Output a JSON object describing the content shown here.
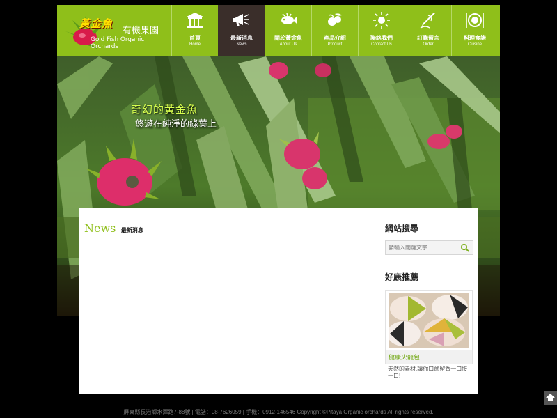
{
  "brand": {
    "stylized": "黃金魚",
    "name_cn": "有機果園",
    "name_en": "Gold Fish Organic Orchards"
  },
  "nav": [
    {
      "label": "首頁",
      "sub": "Home",
      "icon": "gate-icon",
      "active": false
    },
    {
      "label": "最新消息",
      "sub": "News",
      "icon": "megaphone-icon",
      "active": true
    },
    {
      "label": "關於黃金魚",
      "sub": "About Us",
      "icon": "fish-icon",
      "active": false
    },
    {
      "label": "產品介紹",
      "sub": "Product",
      "icon": "fruit-icon",
      "active": false
    },
    {
      "label": "聯絡我們",
      "sub": "Contact Us",
      "icon": "sun-icon",
      "active": false
    },
    {
      "label": "訂購留言",
      "sub": "Order",
      "icon": "pen-icon",
      "active": false
    },
    {
      "label": "料理食譜",
      "sub": "Cuisine",
      "icon": "plate-icon",
      "active": false
    }
  ],
  "banner": {
    "tagline_1": "奇幻的黃金魚",
    "tagline_2": "悠遊在純淨的綠葉上"
  },
  "news": {
    "title_en": "News",
    "title_cn": "最新消息"
  },
  "sidebar": {
    "search_title": "網站搜尋",
    "search_placeholder": "請輸入關鍵文字",
    "recommend_title": "好康推薦",
    "product_name": "健康火龍包",
    "product_desc": "天然的素材,讓你口齒留香一口接一口!"
  },
  "footer": {
    "text": "屏東縣長治鄉水潭路7-88號 | 電話：08-7626059 | 手機：0912-146546 Copyright ©Pitaya Organic orchards All rights reserved."
  },
  "colors": {
    "accent_green": "#8fbf1a",
    "active_nav": "#3a2e2a",
    "background": "#000000"
  }
}
